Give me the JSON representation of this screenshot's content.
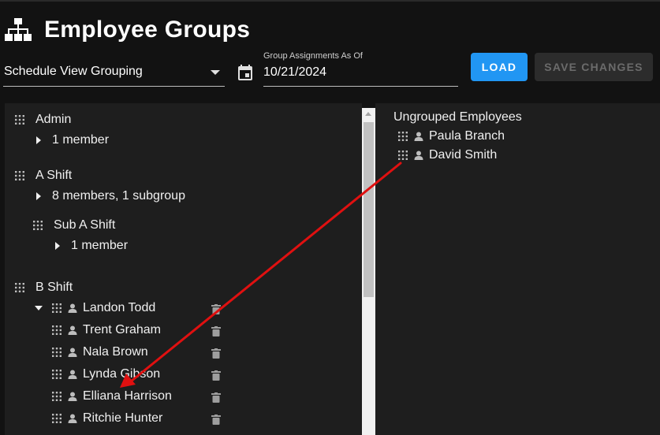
{
  "header": {
    "title": "Employee Groups",
    "logo_icon": "sitemap-icon"
  },
  "controls": {
    "grouping_select_value": "Schedule View Grouping",
    "date_label": "Group Assignments As Of",
    "date_value": "10/21/2024",
    "load_label": "LOAD",
    "save_label": "SAVE CHANGES"
  },
  "groups": [
    {
      "name": "Admin",
      "summary": "1 member"
    },
    {
      "name": "A Shift",
      "summary": "8 members, 1 subgroup"
    },
    {
      "name": "Sub A Shift",
      "summary": "1 member"
    },
    {
      "name": "B Shift",
      "members": [
        "Landon Todd",
        "Trent Graham",
        "Nala Brown",
        "Lynda Gibson",
        "Elliana Harrison",
        "Ritchie Hunter"
      ]
    }
  ],
  "ungrouped": {
    "title": "Ungrouped Employees",
    "employees": [
      "Paula Branch",
      "David Smith"
    ]
  },
  "colors": {
    "accent": "#2196f3",
    "annotation_arrow": "#e01010"
  }
}
